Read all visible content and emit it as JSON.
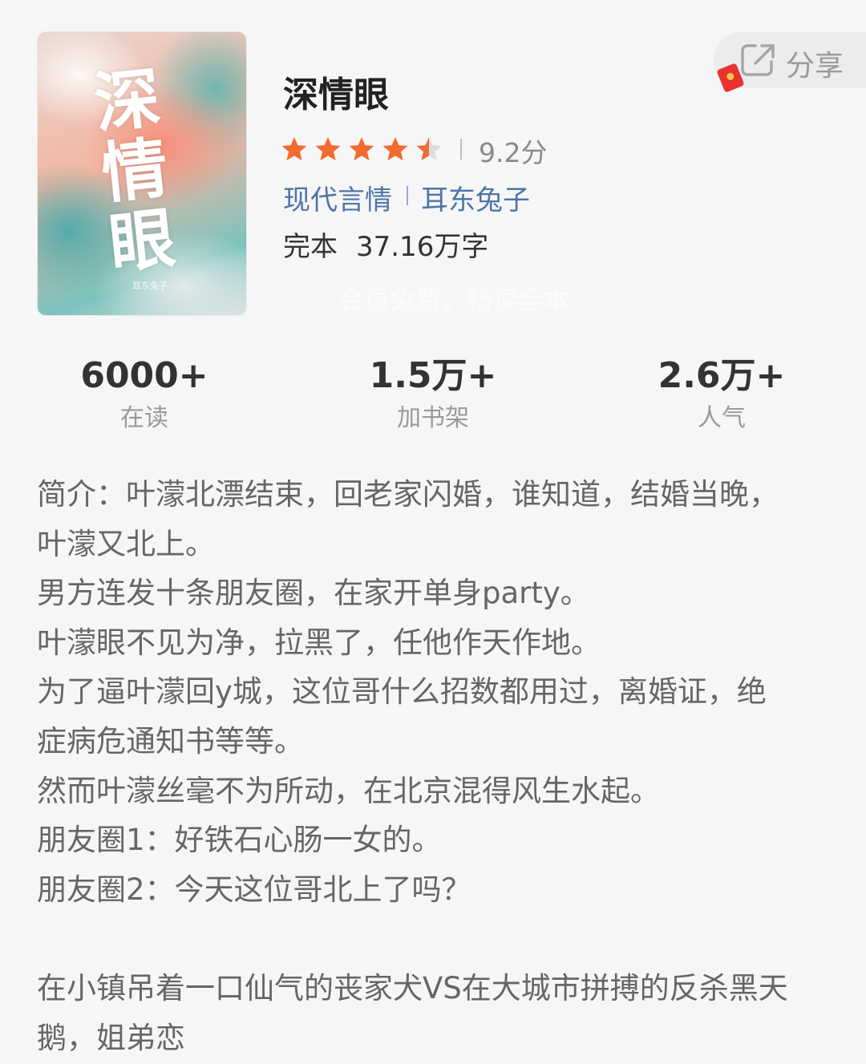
{
  "book": {
    "cover_title": "深情眼",
    "cover_author": "耳东兔子",
    "title": "深情眼",
    "rating": 4.5,
    "rating_text": "9.2分",
    "genre": "现代言情",
    "author": "耳东兔子",
    "status": "完本",
    "word_count": "37.16万字",
    "promo": "会员免费，畅读全本"
  },
  "share": {
    "label": "分享",
    "icon": "share-icon",
    "badge_icon": "red-envelope-icon"
  },
  "stats": [
    {
      "value": "6000+",
      "label": "在读"
    },
    {
      "value": "1.5万+",
      "label": "加书架"
    },
    {
      "value": "2.6万+",
      "label": "人气"
    }
  ],
  "description": {
    "lines": [
      "简介：叶濛北漂结束，回老家闪婚，谁知道，结婚当晚，",
      "叶濛又北上。",
      "男方连发十条朋友圈，在家开单身party。",
      "叶濛眼不见为净，拉黑了，任他作天作地。",
      "为了逼叶濛回y城，这位哥什么招数都用过，离婚证，绝",
      "症病危通知书等等。",
      "然而叶濛丝毫不为所动，在北京混得风生水起。",
      "朋友圈1：好铁石心肠一女的。",
      "朋友圈2：今天这位哥北上了吗？",
      "",
      "在小镇吊着一口仙气的丧家犬VS在大城市拼搏的反杀黑天",
      "鹅，姐弟恋"
    ]
  },
  "colors": {
    "star": "#f26a2f",
    "star_empty": "#dddddd",
    "link": "#4e74a8",
    "background": "#f6f6f7"
  }
}
